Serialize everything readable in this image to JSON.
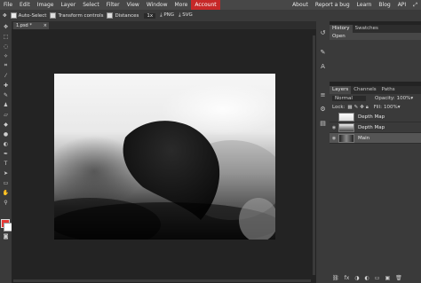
{
  "menubar": {
    "items": [
      "File",
      "Edit",
      "Image",
      "Layer",
      "Select",
      "Filter",
      "View",
      "Window",
      "More",
      "Account"
    ],
    "right": [
      "About",
      "Report a bug",
      "Learn",
      "Blog",
      "API"
    ]
  },
  "options": {
    "auto_select": "Auto-Select",
    "transform_controls": "Transform controls",
    "distances": "Distances",
    "zoom": "1x",
    "png": "PNG",
    "svg": "SVG"
  },
  "document": {
    "tab_label": "1.psd *"
  },
  "history_panel": {
    "tabs": [
      "History",
      "Swatches"
    ],
    "entries": [
      "Open"
    ]
  },
  "layers_panel": {
    "tabs": [
      "Layers",
      "Channels",
      "Paths"
    ],
    "blend_mode": "Normal",
    "opacity_label": "Opacity:",
    "opacity_value": "100%",
    "lock_label": "Lock:",
    "fill_label": "Fill:",
    "fill_value": "100%",
    "layers": [
      {
        "name": "Depth Map",
        "visible": false
      },
      {
        "name": "Depth Map",
        "visible": true
      },
      {
        "name": "Main",
        "visible": true
      }
    ]
  },
  "colors": {
    "accent": "#c62828",
    "foreground": "#e53935",
    "background": "#ffffff"
  }
}
